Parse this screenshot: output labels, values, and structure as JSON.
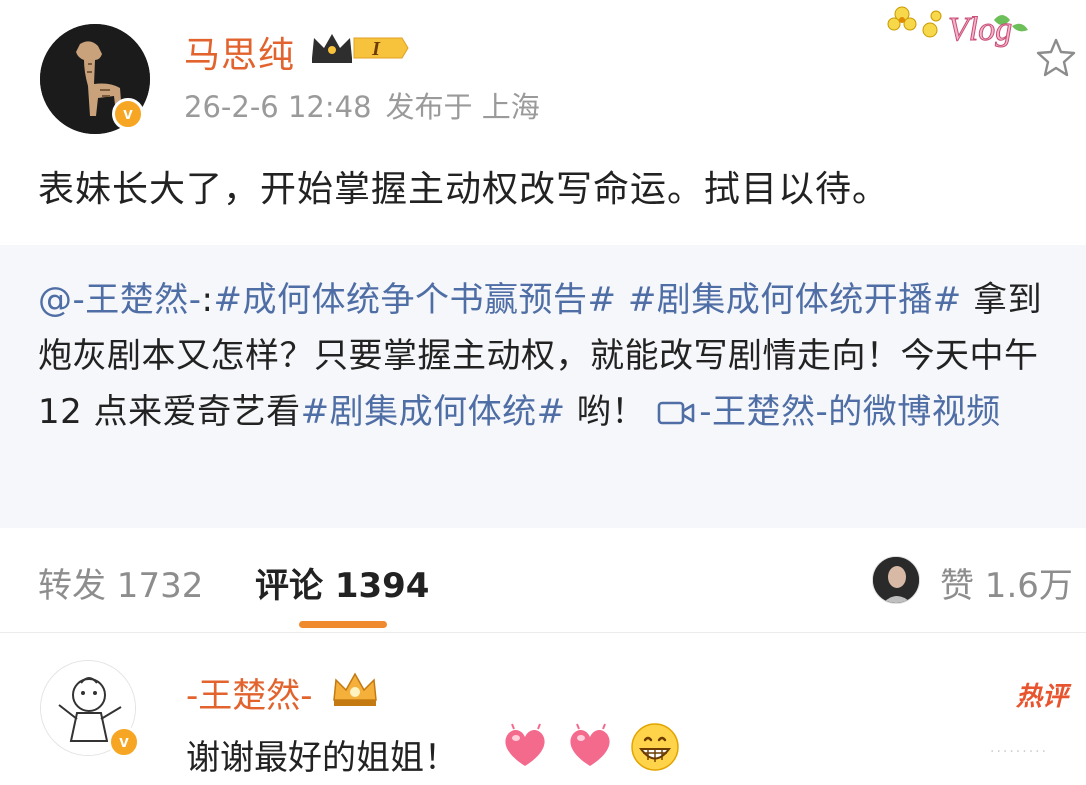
{
  "post": {
    "author": "马思纯",
    "vip_level": "I",
    "date": "26-2-6 12:48",
    "published_in": "发布于 上海",
    "text": "表妹长大了，开始掌握主动权改写命运。拭目以待。",
    "deco_text": "Vlog"
  },
  "repost": {
    "mention": "@-王楚然-",
    "colon": ":",
    "topic1": "#成何体统争个书赢预告#",
    "topic2": "#剧集成何体统开播#",
    "text1": " 拿到炮灰剧本又怎样？只要掌握主动权，就能改写剧情走向！今天中午 12 点来爱奇艺看",
    "topic3": "#剧集成何体统#",
    "text2": " 哟！ ",
    "video_link": "-王楚然-的微博视频"
  },
  "actions": {
    "repost": "转发 1732",
    "comment": "评论 1394",
    "like": "赞 1.6万"
  },
  "comment": {
    "author": "-王楚然-",
    "text": "谢谢最好的姐姐！",
    "hot_label": "热评"
  },
  "colors": {
    "name": "#e2632d",
    "link": "#4e6ea5",
    "accent": "#f08a2e",
    "verified": "#f6a623"
  },
  "icons": [
    "verified-icon",
    "vip-crown-icon",
    "star-icon",
    "camera-icon",
    "heart-emoji",
    "grin-emoji"
  ]
}
